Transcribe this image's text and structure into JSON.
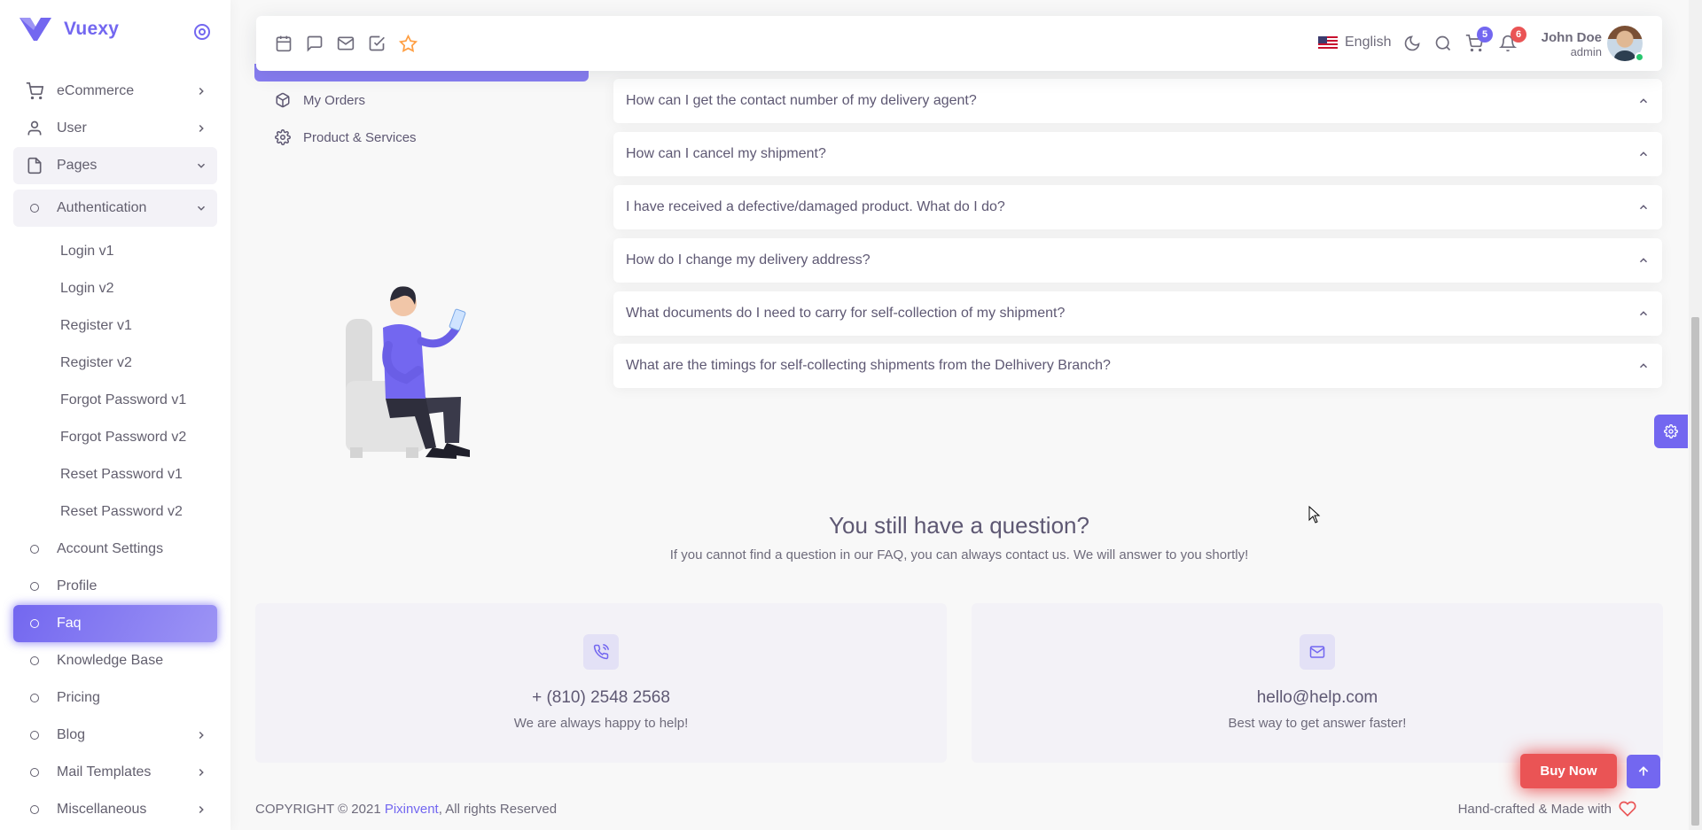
{
  "brand": {
    "name": "Vuexy",
    "color": "#7367f0"
  },
  "sidebar": {
    "items": [
      {
        "label": "eCommerce",
        "icon": "cart-icon",
        "has_arrow": true
      },
      {
        "label": "User",
        "icon": "user-icon",
        "has_arrow": true
      },
      {
        "label": "Pages",
        "icon": "file-icon",
        "expanded": true
      },
      {
        "label": "Authentication",
        "icon": "circle-icon",
        "expanded": true
      },
      {
        "label": "Account Settings",
        "icon": "circle-icon"
      },
      {
        "label": "Profile",
        "icon": "circle-icon"
      },
      {
        "label": "Faq",
        "icon": "circle-icon",
        "active": true
      },
      {
        "label": "Knowledge Base",
        "icon": "circle-icon"
      },
      {
        "label": "Pricing",
        "icon": "circle-icon"
      },
      {
        "label": "Blog",
        "icon": "circle-icon",
        "has_arrow": true
      },
      {
        "label": "Mail Templates",
        "icon": "circle-icon",
        "has_arrow": true
      },
      {
        "label": "Miscellaneous",
        "icon": "circle-icon",
        "has_arrow": true
      }
    ],
    "auth_subitems": [
      "Login v1",
      "Login v2",
      "Register v1",
      "Register v2",
      "Forgot Password v1",
      "Forgot Password v2",
      "Reset Password v1",
      "Reset Password v2"
    ]
  },
  "navbar": {
    "shortcut_icons": [
      "calendar-icon",
      "message-square-icon",
      "mail-icon",
      "check-square-icon",
      "star-icon"
    ],
    "language": "English",
    "cart_count": "5",
    "notification_count": "6",
    "user_name": "John Doe",
    "user_role": "admin"
  },
  "faq_nav": [
    {
      "label": "My Orders",
      "icon": "package-icon"
    },
    {
      "label": "Product & Services",
      "icon": "settings-icon"
    }
  ],
  "questions": [
    "How can I get the contact number of my delivery agent?",
    "How can I cancel my shipment?",
    "I have received a defective/damaged product. What do I do?",
    "How do I change my delivery address?",
    "What documents do I need to carry for self-collection of my shipment?",
    "What are the timings for self-collecting shipments from the Delhivery Branch?"
  ],
  "contact": {
    "title": "You still have a question?",
    "subtitle": "If you cannot find a question in our FAQ, you can always contact us. We will answer to you shortly!",
    "phone": {
      "value": "+ (810) 2548 2568",
      "note": "We are always happy to help!"
    },
    "email": {
      "value": "hello@help.com",
      "note": "Best way to get answer faster!"
    }
  },
  "footer": {
    "copyright": "COPYRIGHT © 2021",
    "company": "Pixinvent",
    "rights": ", All rights Reserved",
    "right_text": "Hand-crafted & Made with"
  },
  "buttons": {
    "buy_now": "Buy Now"
  },
  "colors": {
    "primary": "#7367f0",
    "danger": "#ea5455",
    "success": "#28c76f"
  }
}
